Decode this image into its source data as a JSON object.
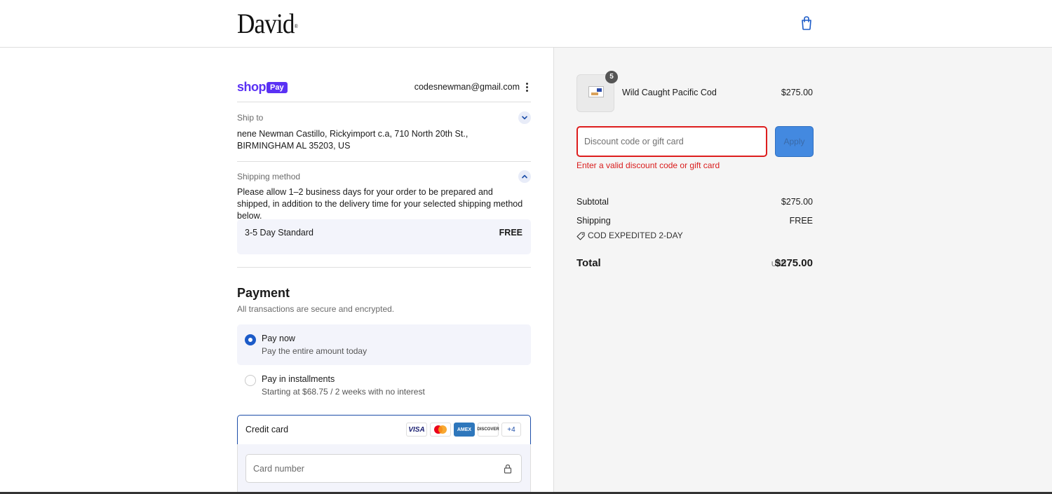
{
  "header": {
    "logo": "David",
    "logo_mark": "®",
    "cart_icon": "shopping-bag-icon"
  },
  "shoppay": {
    "brand": "shop",
    "badge": "Pay",
    "email": "codesnewman@gmail.com",
    "brand_color": "#5a31f4"
  },
  "ship_to": {
    "label": "Ship to",
    "address": "nene Newman Castillo, Rickyimport c.a, 710 North 20th St., BIRMINGHAM AL 35203, US"
  },
  "shipping_method": {
    "label": "Shipping method",
    "note": "Please allow 1–2 business days for your order to be prepared and shipped, in addition to the delivery time for your selected shipping method below.",
    "option_name": "3-5 Day Standard",
    "option_price": "FREE"
  },
  "payment": {
    "title": "Payment",
    "subtitle": "All transactions are secure and encrypted.",
    "options": [
      {
        "title": "Pay now",
        "subtitle": "Pay the entire amount today",
        "selected": true
      },
      {
        "title": "Pay in installments",
        "subtitle": "Starting at $68.75 / 2 weeks with no interest",
        "selected": false
      }
    ],
    "credit_card_label": "Credit card",
    "card_brands": [
      "VISA",
      "mastercard",
      "AMEX",
      "DISCOVER"
    ],
    "more_brands": "+4",
    "card_number_placeholder": "Card number"
  },
  "summary": {
    "product": {
      "name": "Wild Caught Pacific Cod",
      "price": "$275.00",
      "quantity": "5"
    },
    "discount": {
      "placeholder": "Discount code or gift card",
      "apply_label": "Apply",
      "error": "Enter a valid discount code or gift card"
    },
    "subtotal_label": "Subtotal",
    "subtotal_value": "$275.00",
    "shipping_label": "Shipping",
    "shipping_value": "FREE",
    "shipping_tag": "COD EXPEDITED 2-DAY",
    "total_label": "Total",
    "currency": "USD",
    "total_value": "$275.00"
  },
  "colors": {
    "accent": "#1c5bc8",
    "error": "#d91c1c",
    "apply_button": "#4389e0"
  }
}
